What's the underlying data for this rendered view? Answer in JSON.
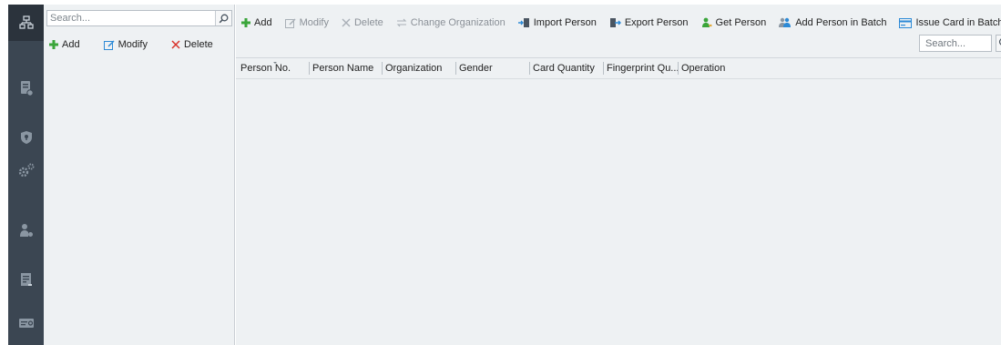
{
  "nav": {
    "items": [
      {
        "id": "organization",
        "icon": "organization-icon",
        "active": true
      },
      {
        "id": "schedule",
        "icon": "schedule-icon",
        "active": false
      },
      {
        "id": "access-shield",
        "icon": "shield-icon",
        "active": false
      },
      {
        "id": "settings",
        "icon": "gears-icon",
        "active": false
      },
      {
        "id": "person",
        "icon": "person-icon",
        "active": false
      },
      {
        "id": "report",
        "icon": "report-icon",
        "active": false
      },
      {
        "id": "card",
        "icon": "card-icon",
        "active": false
      }
    ]
  },
  "org_panel": {
    "search_placeholder": "Search...",
    "toolbar": {
      "add": "Add",
      "modify": "Modify",
      "delete": "Delete"
    }
  },
  "person_toolbar": {
    "add": "Add",
    "modify": "Modify",
    "delete": "Delete",
    "change_organization": "Change Organization",
    "import_person": "Import Person",
    "export_person": "Export Person",
    "get_person": "Get Person",
    "add_person_in_batch": "Add Person in Batch",
    "issue_card_in_batch": "Issue Card in Batch"
  },
  "person_search_placeholder": "Search...",
  "table": {
    "columns": [
      "Person No.",
      "Person Name",
      "Organization",
      "Gender",
      "Card Quantity",
      "Fingerprint Qu...",
      "Operation"
    ],
    "rows": []
  },
  "colors": {
    "rail": "#3b4652",
    "rail_active": "#2b333c",
    "panel_bg": "#eef1f3",
    "add_green": "#3aa53a",
    "delete_red": "#d8322b",
    "icon_blue": "#2d8ad6"
  }
}
